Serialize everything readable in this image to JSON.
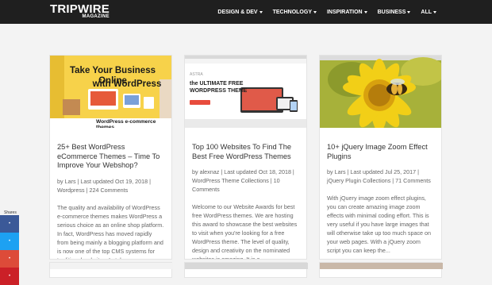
{
  "logo": {
    "line1": "TRIPWIRE",
    "line2": "MAGAZINE"
  },
  "nav": {
    "items": [
      {
        "label": "DESIGN & DEV"
      },
      {
        "label": "TECHNOLOGY"
      },
      {
        "label": "INSPIRATION"
      },
      {
        "label": "BUSINESS"
      },
      {
        "label": "ALL"
      }
    ]
  },
  "cards": [
    {
      "thumb": {
        "headline1": "Take Your Business Online",
        "headline2": "with WordPress",
        "footer": "WordPress e-commerce themes"
      },
      "title": "25+ Best WordPress eCommerce Themes – Time To Improve Your Webshop?",
      "meta": "by Lars | Last updated Oct 19, 2018 | Wordpress | 224 Comments",
      "excerpt": "The quality and availability of WordPress e-commerce themes makes WordPress a serious choice as an online shop platform. In fact, WordPress has moved rapidly from being mainly a blogging platform and is now one of the top CMS systems for traditional websites. Lately,..."
    },
    {
      "thumb": {
        "tag": "ASTRA",
        "headline1": "the ULTIMATE FREE",
        "headline2": "WORDPRESS THEME"
      },
      "title": "Top 100 Websites To Find The Best Free WordPress Themes",
      "meta": "by alexnaz | Last updated Oct 18, 2018 | WordPress Theme Collections | 10 Comments",
      "excerpt": "Welcome to our Website Awards for best free WordPress themes. We are hosting this award to showcase the best websites to visit when you're looking for a free WordPress theme. The level of quality, design and creativity on the nominated websites is amazing. It is a..."
    },
    {
      "thumb": {},
      "title": "10+ jQuery Image Zoom Effect Plugins",
      "meta": "by Lars | Last updated Jul 25, 2017 | jQuery Plugin Collections | 71 Comments",
      "excerpt": "With jQuery image zoom effect plugins, you can create amazing image zoom effects with minimal coding effort. This is very useful if you have large images that will otherwise take up too much space on your web pages. With a jQuery zoom script you can keep the..."
    }
  ],
  "shares": {
    "label": "Shares",
    "colors": [
      "#3b5998",
      "#1da1f2",
      "#dd4b39",
      "#cb2027"
    ]
  },
  "colors": {
    "topbar": "#1f1f1f",
    "page_bg": "#f3f3f3",
    "thumb1_bg": "#f7d24a",
    "thumb3_bg": "#a7b13a"
  }
}
